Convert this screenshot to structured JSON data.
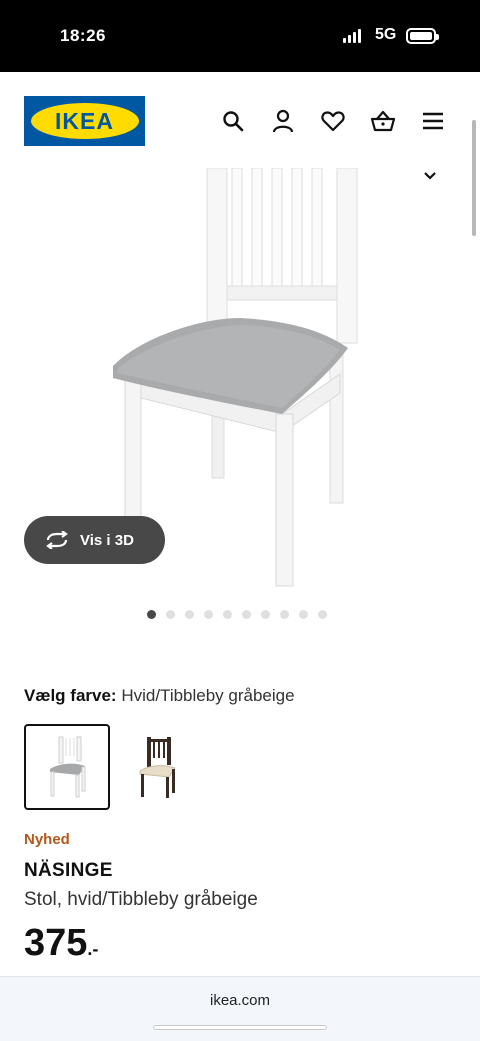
{
  "status_bar": {
    "time": "18:26",
    "network": "5G",
    "battery_level": 1.0
  },
  "header": {
    "logo_text": "IKEA",
    "icons": [
      "search-icon",
      "account-icon",
      "heart-icon",
      "cart-icon",
      "menu-icon"
    ]
  },
  "gallery": {
    "view_3d_label": "Vis i 3D",
    "image_count": 10,
    "active_index": 0
  },
  "color_select": {
    "label": "Vælg farve:",
    "value": "Hvid/Tibbleby gråbeige"
  },
  "product": {
    "badge": "Nyhed",
    "name": "NÄSINGE",
    "description": "Stol, hvid/Tibbleby gråbeige",
    "price": "375",
    "price_suffix": ".-"
  },
  "browser": {
    "url": "ikea.com"
  },
  "colors": {
    "brand_blue": "#0058a3",
    "brand_yellow": "#ffdb00",
    "badge_orange": "#b5581a"
  }
}
